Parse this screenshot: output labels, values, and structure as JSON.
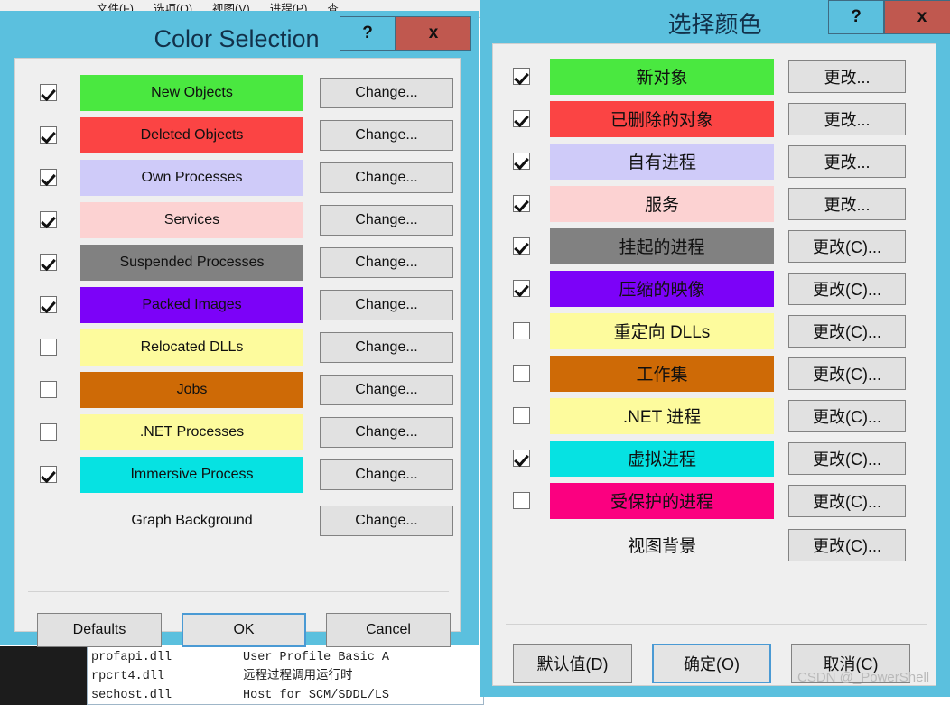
{
  "background": {
    "menu": [
      {
        "label": "文件(F)"
      },
      {
        "label": "选项(O)"
      },
      {
        "label": "视图(V)"
      },
      {
        "label": "进程(P)"
      },
      {
        "label": "查"
      }
    ],
    "list_rows": [
      {
        "module": "profapi.dll",
        "description": "User Profile Basic A"
      },
      {
        "module": "rpcrt4.dll",
        "description": "远程过程调用运行时"
      },
      {
        "module": "sechost.dll",
        "description": "Host for SCM/SDDL/LS"
      }
    ]
  },
  "watermark": "CSDN @_PowerShell",
  "dialog_left": {
    "title": "Color Selection",
    "help_label": "?",
    "close_label": "x",
    "titlebar_color": "#5bc0de",
    "close_color": "#c0584f",
    "rows": [
      {
        "checked": true,
        "label": "New Objects",
        "color": "#4ae840",
        "button": "Change..."
      },
      {
        "checked": true,
        "label": "Deleted Objects",
        "color": "#fb4444",
        "button": "Change..."
      },
      {
        "checked": true,
        "label": "Own Processes",
        "color": "#cfcbf9",
        "button": "Change..."
      },
      {
        "checked": true,
        "label": "Services",
        "color": "#fcd2d2",
        "button": "Change..."
      },
      {
        "checked": true,
        "label": "Suspended Processes",
        "color": "#818181",
        "button": "Change..."
      },
      {
        "checked": true,
        "label": "Packed Images",
        "color": "#7c02f8",
        "button": "Change..."
      },
      {
        "checked": false,
        "label": "Relocated DLLs",
        "color": "#fdfb9d",
        "button": "Change..."
      },
      {
        "checked": false,
        "label": "Jobs",
        "color": "#ce6a06",
        "button": "Change..."
      },
      {
        "checked": false,
        "label": ".NET Processes",
        "color": "#fdfb9d",
        "button": "Change..."
      },
      {
        "checked": true,
        "label": "Immersive Process",
        "color": "#06e2e2",
        "button": "Change..."
      }
    ],
    "extra_row": {
      "label": "Graph Background",
      "button": "Change..."
    },
    "footer": [
      {
        "label": "Defaults",
        "default": false
      },
      {
        "label": "OK",
        "default": true
      },
      {
        "label": "Cancel",
        "default": false
      }
    ]
  },
  "dialog_right": {
    "title": "选择颜色",
    "help_label": "?",
    "close_label": "x",
    "titlebar_color": "#5bc0de",
    "close_color": "#c0584f",
    "rows": [
      {
        "checked": true,
        "label": "新对象",
        "color": "#4ae840",
        "button": "更改..."
      },
      {
        "checked": true,
        "label": "已删除的对象",
        "color": "#fb4444",
        "button": "更改..."
      },
      {
        "checked": true,
        "label": "自有进程",
        "color": "#cfcbf9",
        "button": "更改..."
      },
      {
        "checked": true,
        "label": "服务",
        "color": "#fcd2d2",
        "button": "更改..."
      },
      {
        "checked": true,
        "label": "挂起的进程",
        "color": "#818181",
        "button": "更改(C)..."
      },
      {
        "checked": true,
        "label": "压缩的映像",
        "color": "#7c02f8",
        "button": "更改(C)..."
      },
      {
        "checked": false,
        "label": "重定向 DLLs",
        "color": "#fdfb9d",
        "button": "更改(C)..."
      },
      {
        "checked": false,
        "label": "工作集",
        "color": "#ce6a06",
        "button": "更改(C)..."
      },
      {
        "checked": false,
        "label": ".NET 进程",
        "color": "#fdfb9d",
        "button": "更改(C)..."
      },
      {
        "checked": true,
        "label": "虚拟进程",
        "color": "#06e2e2",
        "button": "更改(C)..."
      },
      {
        "checked": false,
        "label": "受保护的进程",
        "color": "#fb0080",
        "button": "更改(C)..."
      }
    ],
    "extra_row": {
      "label": "视图背景",
      "button": "更改(C)..."
    },
    "footer": [
      {
        "label": "默认值(D)",
        "default": false
      },
      {
        "label": "确定(O)",
        "default": true
      },
      {
        "label": "取消(C)",
        "default": false
      }
    ]
  }
}
